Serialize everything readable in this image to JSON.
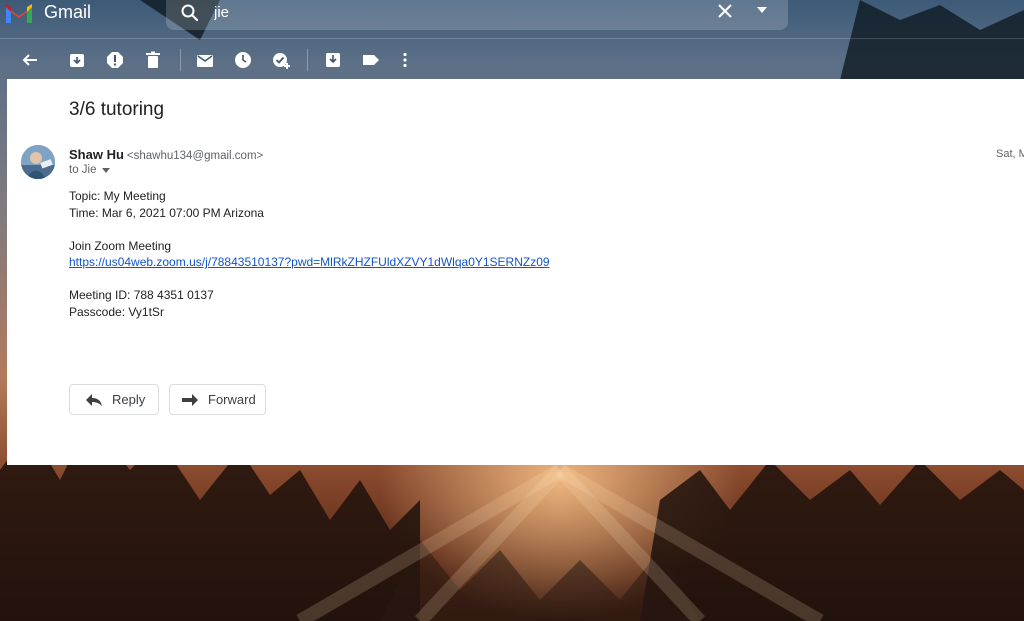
{
  "app": {
    "name": "Gmail"
  },
  "search": {
    "value": "jie"
  },
  "message": {
    "subject": "3/6 tutoring",
    "sender_name": "Shaw Hu",
    "sender_email": "<shawhu134@gmail.com>",
    "to_label": "to Jie",
    "date": "Sat, M",
    "body": {
      "line1": "Topic: My Meeting",
      "line2": "Time: Mar 6, 2021 07:00 PM Arizona",
      "line3": "Join Zoom Meeting",
      "link": "https://us04web.zoom.us/j/78843510137?pwd=MlRkZHZFUldXZVY1dWlqa0Y1SERNZz09",
      "line4": "Meeting ID: 788 4351 0137",
      "line5": "Passcode: Vy1tSr"
    }
  },
  "actions": {
    "reply_label": "Reply",
    "forward_label": "Forward"
  },
  "colors": {
    "link": "#1155cc",
    "panel_bg": "#ffffff",
    "text": "#202124"
  }
}
